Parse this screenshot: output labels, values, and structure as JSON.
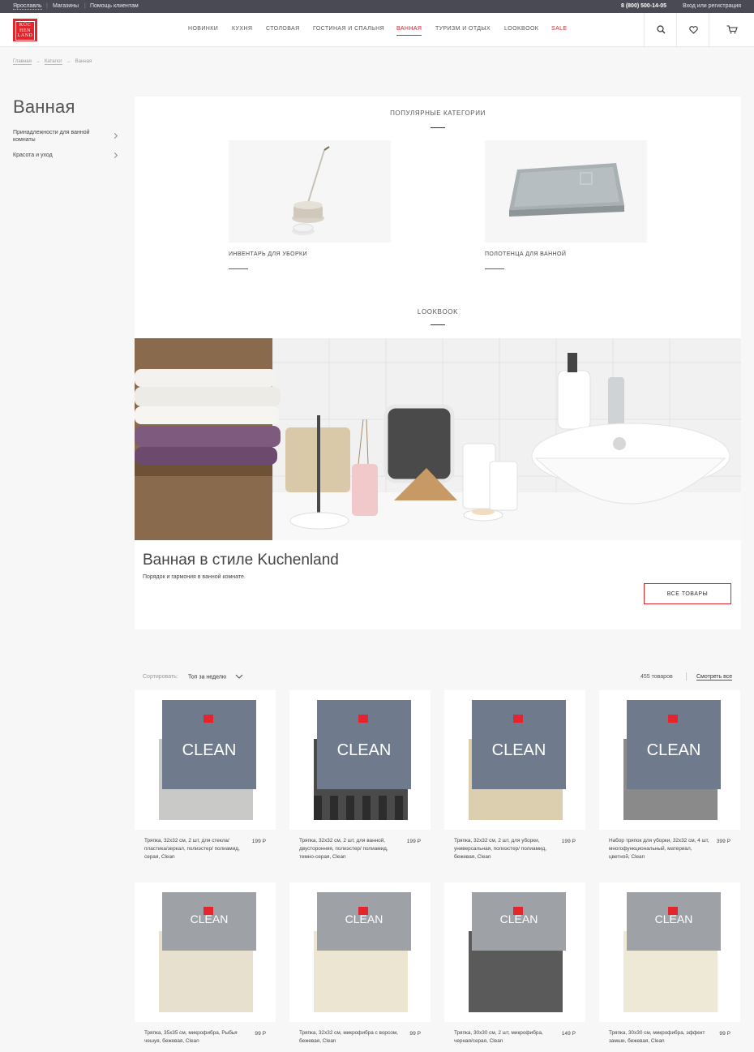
{
  "topbar": {
    "city": "Ярославль",
    "stores": "Магазины",
    "help": "Помощь клиентам",
    "phone": "8 (800) 500-14-05",
    "login": "Вход или регистрация"
  },
  "logo": {
    "line1": "KÜC",
    "line2": "HEN",
    "line3": "LAND"
  },
  "nav": {
    "new": "НОВИНКИ",
    "kitchen": "КУХНЯ",
    "dining": "СТОЛОВАЯ",
    "living": "ГОСТИНАЯ И СПАЛЬНЯ",
    "bath": "ВАННАЯ",
    "tourism": "ТУРИЗМ И ОТДЫХ",
    "lookbook": "LOOKBOOK",
    "sale": "SALE"
  },
  "breadcrumb": {
    "home": "Главная",
    "catalog": "Каталог",
    "current": "Ванная",
    "arrow": "→"
  },
  "sidebar": {
    "title": "Ванная",
    "items": [
      {
        "label": "Принадлежности для ванной комнаты"
      },
      {
        "label": "Красота и уход"
      }
    ]
  },
  "popular": {
    "title": "ПОПУЛЯРНЫЕ КАТЕГОРИИ",
    "categories": [
      {
        "label": "ИНВЕНТАРЬ ДЛЯ УБОРКИ"
      },
      {
        "label": "ПОЛОТЕНЦА ДЛЯ ВАННОЙ"
      }
    ]
  },
  "lookbook": {
    "title": "LOOKBOOK",
    "heading": "Ванная в стиле Kuchenland",
    "subtitle": "Порядок и гармония в ванной комнате.",
    "button": "ВСЕ ТОВАРЫ"
  },
  "sort": {
    "label": "Сортировать:",
    "value": "Топ за неделю",
    "count": "455 товаров",
    "show_all": "Смотреть все"
  },
  "package_brand": "CLEAN",
  "package_maker": "KüchenLand",
  "products": [
    {
      "name": "Тряпка, 32х32 см, 2 шт, для стекла/ пластика/зеркал, полиэстер/ полиамид, серая, Clean",
      "price": "199 Р"
    },
    {
      "name": "Тряпка, 32х32 см, 2 шт, для ванной, двусторонняя, полиэстер/ полиамид, темно-серая, Clean",
      "price": "199 Р"
    },
    {
      "name": "Тряпка, 32х32 см, 2 шт, для уборки, универсальная, полиэстер/ полиамид, бежевая, Clean",
      "price": "199 Р"
    },
    {
      "name": "Набор тряпок для уборки, 32х32 см, 4 шт, многофункциональный, материал, цветной, Clean",
      "price": "399 Р"
    },
    {
      "name": "Тряпка, 35х35 см, микрофибра, Рыбья чешуя, бежевая, Clean",
      "price": "99 Р"
    },
    {
      "name": "Тряпка, 32х32 см, микрофибра с ворсом, бежевая, Clean",
      "price": "99 Р"
    },
    {
      "name": "Тряпка, 30х30 см, 2 шт, микрофибра, черная/серая, Clean",
      "price": "149 Р"
    },
    {
      "name": "Тряпка, 30х30 см, микрофибра, эффект замши, бежевая, Clean",
      "price": "99 Р"
    }
  ]
}
